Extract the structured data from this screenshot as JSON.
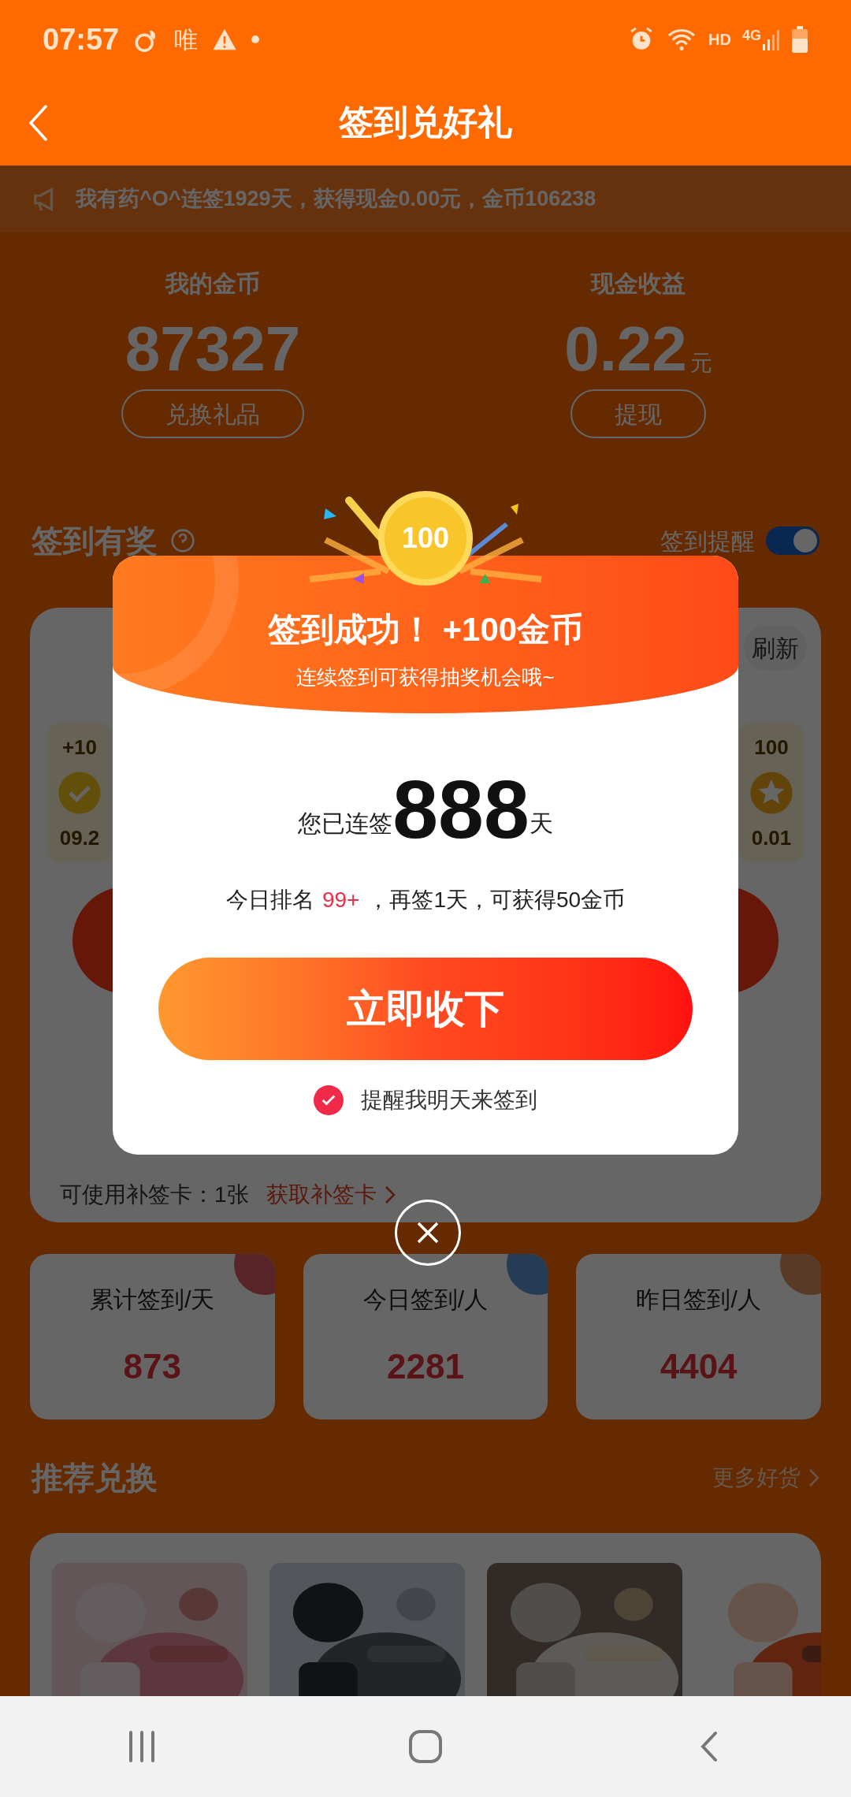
{
  "status_bar": {
    "time": "07:57",
    "app_glyph": "唯",
    "hd": "HD",
    "network": "4G"
  },
  "header": {
    "title": "签到兑好礼"
  },
  "notice": {
    "text": "我有药^O^连签1929天，获得现金0.00元，金币106238"
  },
  "assets": [
    {
      "label": "我的金币",
      "value": "87327",
      "button": "兑换礼品"
    },
    {
      "label": "现金收益",
      "value": "0.22",
      "unit": "元",
      "button": "提现"
    }
  ],
  "checkin": {
    "title": "签到有奖",
    "reminder_label": "签到提醒",
    "reminder_on": true,
    "refresh": "刷新",
    "days": [
      {
        "reward": "+10",
        "date": "09.2",
        "kind": "done"
      },
      {
        "reward": "100",
        "date": "0.01",
        "kind": "star"
      }
    ],
    "makeup_text": "可使用补签卡：1张",
    "makeup_link": "获取补签卡"
  },
  "stats": [
    {
      "label": "累计签到/天",
      "value": "873",
      "color": "#582428"
    },
    {
      "label": "今日签到/人",
      "value": "2281",
      "color": "#243c56"
    },
    {
      "label": "昨日签到/人",
      "value": "4404",
      "color": "#583a26"
    }
  ],
  "recommend": {
    "title": "推荐兑换",
    "more": "更多好货"
  },
  "dialog": {
    "coin": "100",
    "title": "签到成功！ +100金币",
    "subtitle": "连续签到可获得抽奖机会哦~",
    "streak_prefix": "您已连签",
    "streak": "888",
    "streak_suffix": "天",
    "rank_prefix": "今日排名",
    "rank": "99+",
    "rank_suffix": "，再签1天，可获得50金币",
    "button": "立即收下",
    "remind_checked": true,
    "remind_label": "提醒我明天来签到"
  }
}
